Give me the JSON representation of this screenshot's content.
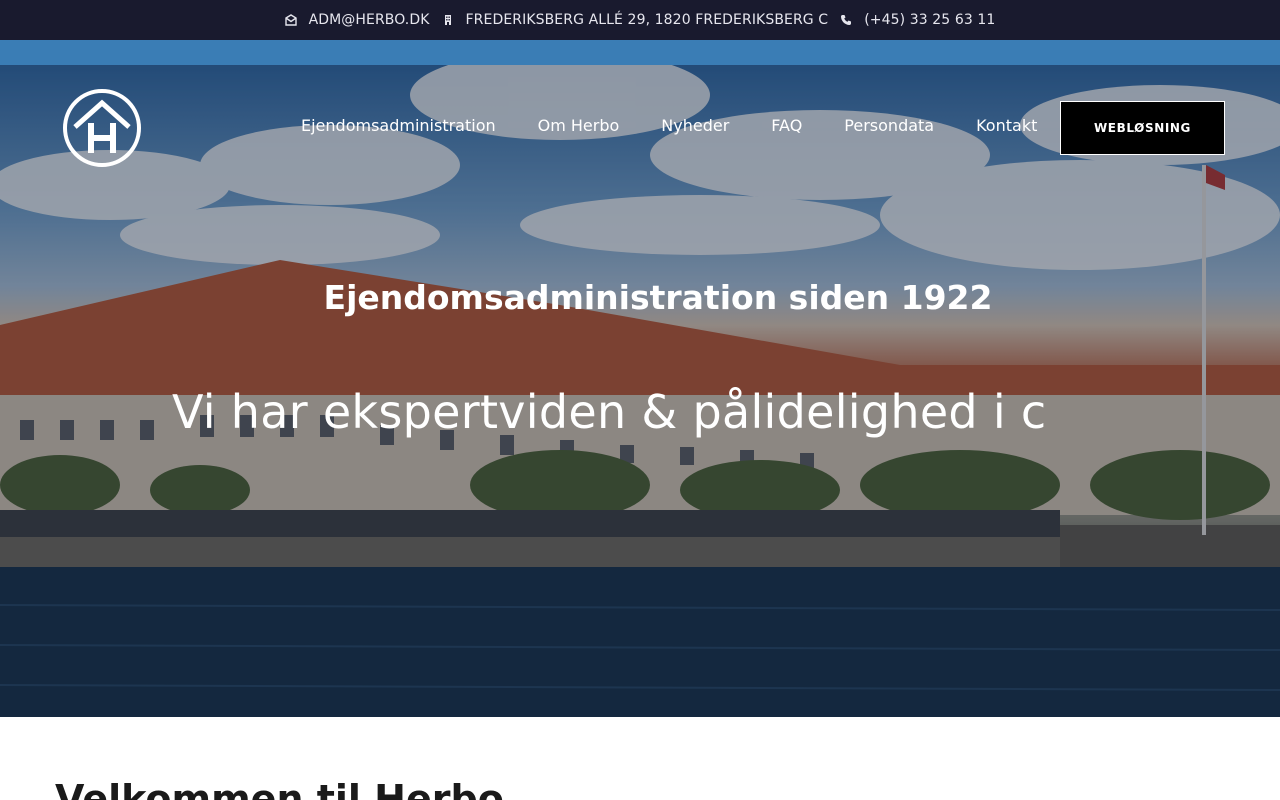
{
  "topbar": {
    "email": "ADM@HERBO.DK",
    "address": "FREDERIKSBERG ALLÉ 29, 1820 FREDERIKSBERG C",
    "phone": "(+45) 33 25 63 11"
  },
  "nav": {
    "items": [
      "Ejendomsadministration",
      "Om Herbo",
      "Nyheder",
      "FAQ",
      "Persondata",
      "Kontakt"
    ],
    "cta_label": "WEBLØSNING"
  },
  "hero": {
    "title": "Ejendomsadministration siden 1922",
    "subtitle": "Vi har ekspertviden & pålidelighed i c"
  },
  "welcome": {
    "heading": "Velkommen til Herbo"
  },
  "colors": {
    "topbar_bg": "#191a2e",
    "stripe": "#3a7db5",
    "cta_bg": "#000000",
    "text_light": "#ffffff"
  },
  "icons": {
    "email": "envelope-icon",
    "address": "building-icon",
    "phone": "phone-icon",
    "logo": "house-h-logo"
  }
}
